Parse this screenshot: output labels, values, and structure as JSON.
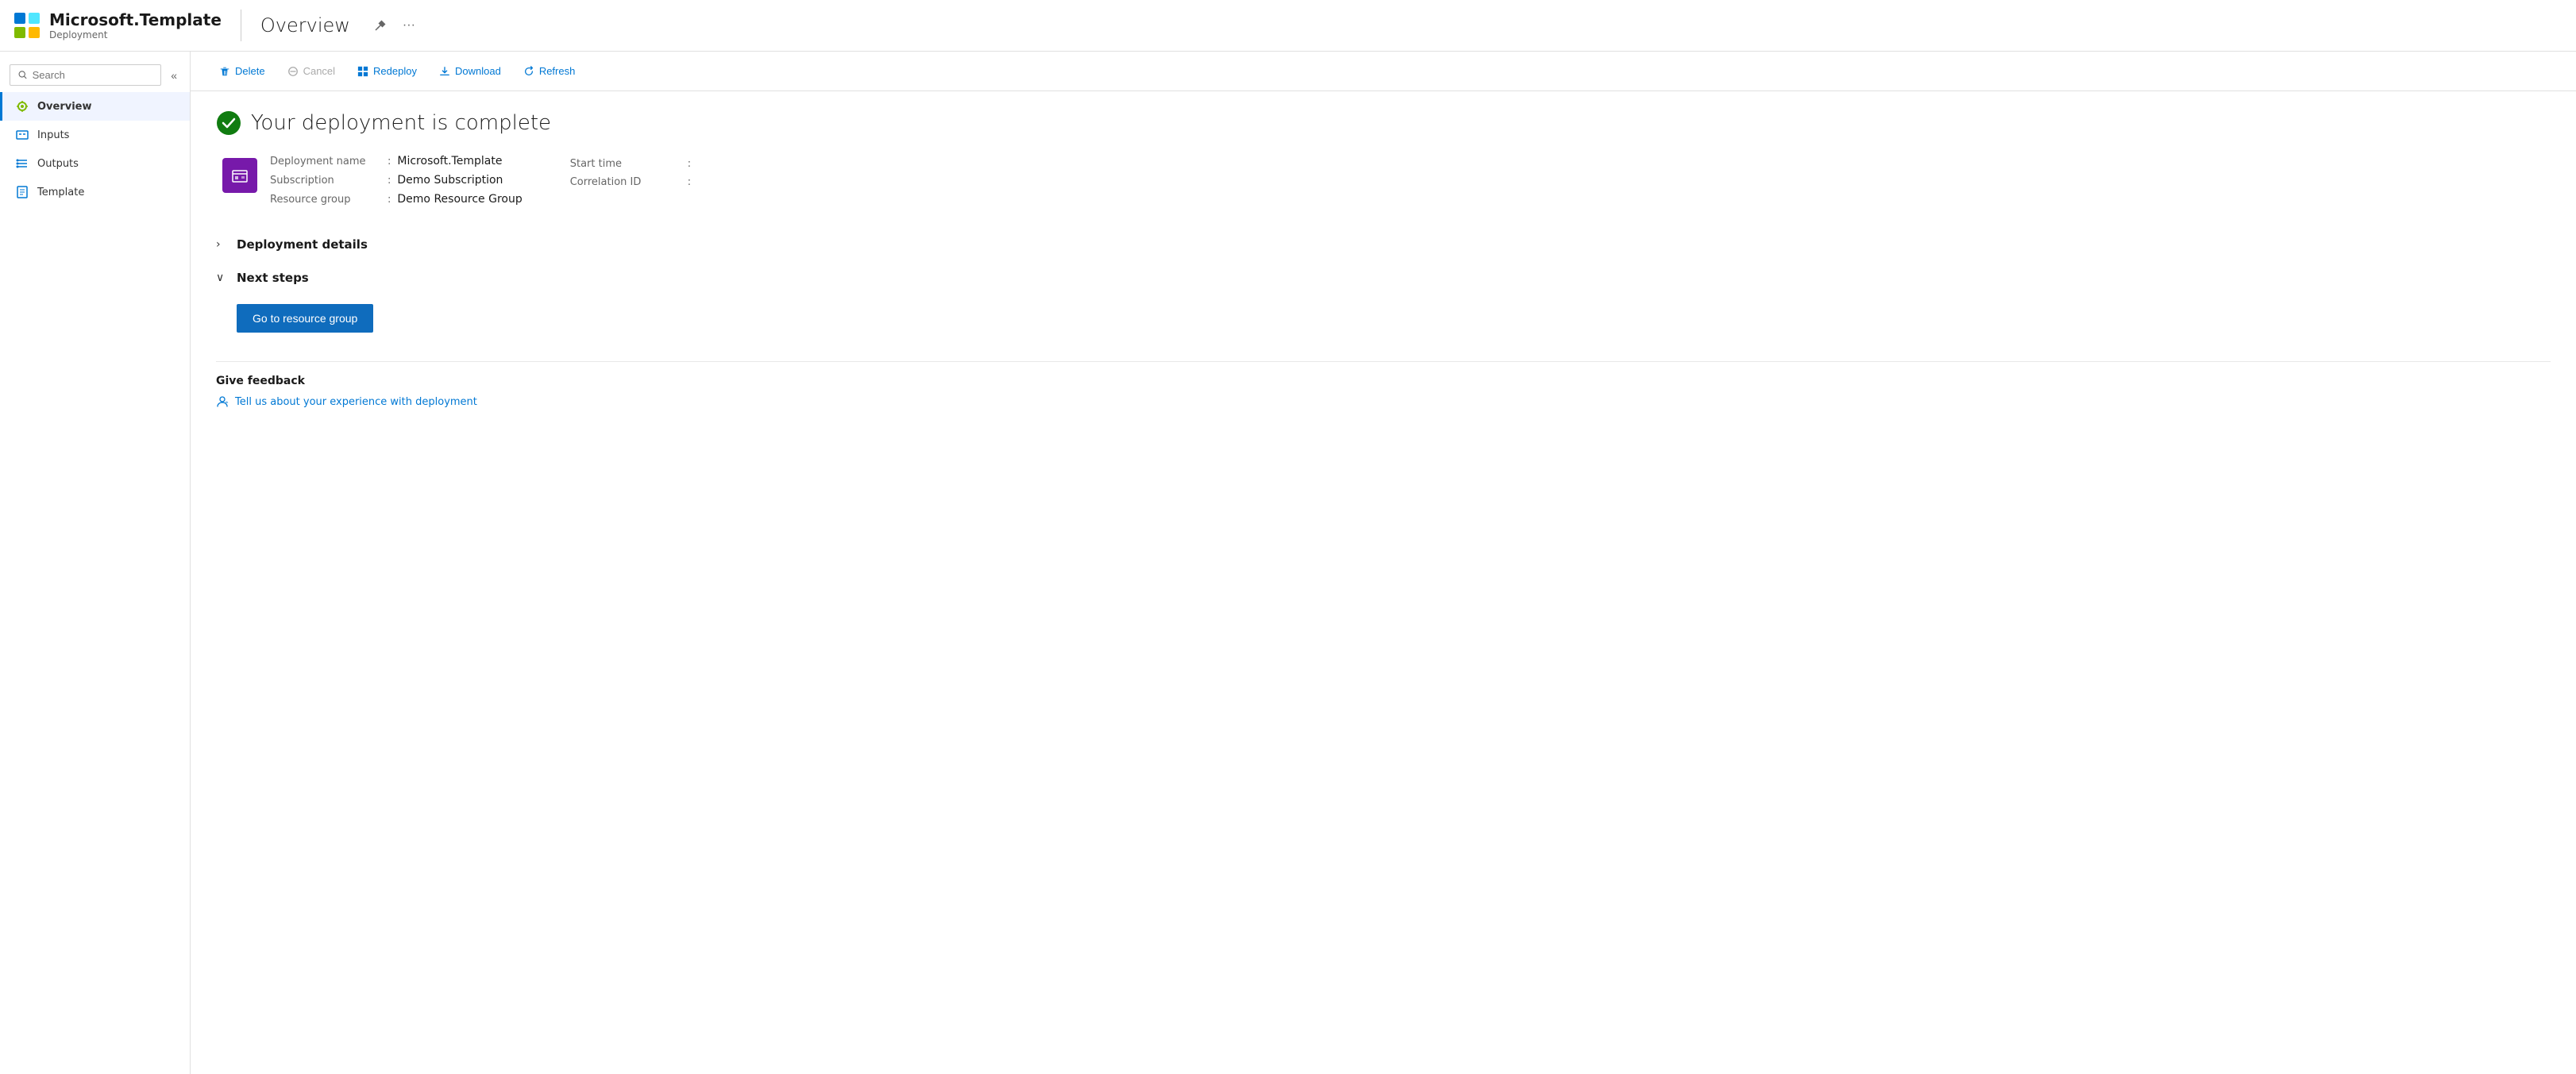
{
  "header": {
    "app_name": "Microsoft.Template",
    "app_subtitle": "Deployment",
    "page_title": "Overview",
    "pin_icon": "📌",
    "more_icon": "···"
  },
  "search": {
    "placeholder": "Search"
  },
  "sidebar": {
    "collapse_label": "«",
    "items": [
      {
        "id": "overview",
        "label": "Overview",
        "icon": "overview-icon",
        "active": true
      },
      {
        "id": "inputs",
        "label": "Inputs",
        "icon": "inputs-icon",
        "active": false
      },
      {
        "id": "outputs",
        "label": "Outputs",
        "icon": "outputs-icon",
        "active": false
      },
      {
        "id": "template",
        "label": "Template",
        "icon": "template-icon",
        "active": false
      }
    ]
  },
  "toolbar": {
    "delete_label": "Delete",
    "cancel_label": "Cancel",
    "redeploy_label": "Redeploy",
    "download_label": "Download",
    "refresh_label": "Refresh"
  },
  "main": {
    "success_message": "Your deployment is complete",
    "deployment": {
      "name_label": "Deployment name",
      "name_value": "Microsoft.Template",
      "subscription_label": "Subscription",
      "subscription_value": "Demo Subscription",
      "resource_group_label": "Resource group",
      "resource_group_value": "Demo Resource Group",
      "start_time_label": "Start time",
      "start_time_value": "",
      "correlation_id_label": "Correlation ID",
      "correlation_id_value": ""
    },
    "deployment_details": {
      "title": "Deployment details",
      "expanded": false
    },
    "next_steps": {
      "title": "Next steps",
      "expanded": true,
      "go_to_resource_btn": "Go to resource group"
    },
    "feedback": {
      "title": "Give feedback",
      "link_text": "Tell us about your experience with deployment"
    }
  }
}
